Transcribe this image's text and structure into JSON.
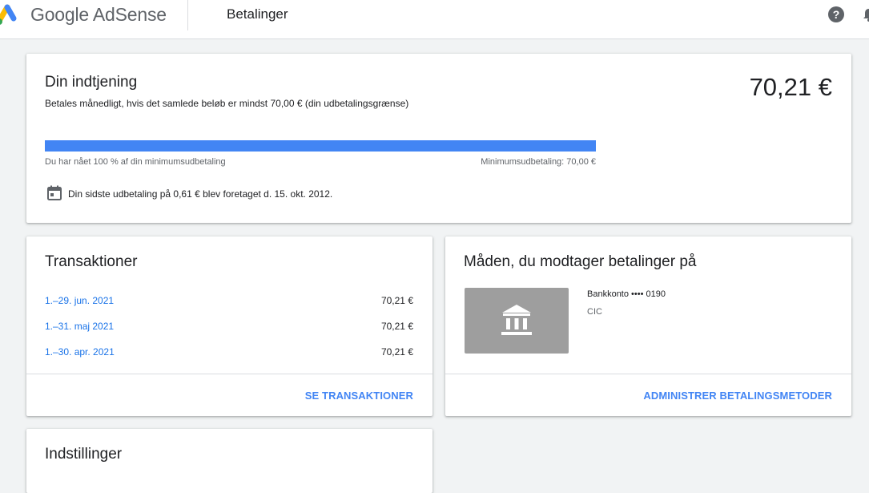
{
  "header": {
    "brand": "Google AdSense",
    "page_title": "Betalinger",
    "icons": {
      "help": "help-icon",
      "notifications": "bell-icon",
      "logo": "adsense-logo-icon"
    }
  },
  "earnings": {
    "title": "Din indtjening",
    "subtitle": "Betales månedligt, hvis det samlede beløb er mindst 70,00 € (din udbetalingsgrænse)",
    "amount": "70,21 €",
    "progress_percent": 100,
    "progress_caption": "Du har nået 100 % af din minimumsudbetaling",
    "threshold_caption": "Minimumsudbetaling: 70,00 €",
    "last_payment": "Din sidste udbetaling på 0,61 € blev foretaget d. 15. okt. 2012.",
    "calendar_icon": "calendar-icon"
  },
  "transactions": {
    "title": "Transaktioner",
    "rows": [
      {
        "period": "1.–29. jun. 2021",
        "amount": "70,21 €"
      },
      {
        "period": "1.–31. maj 2021",
        "amount": "70,21 €"
      },
      {
        "period": "1.–30. apr. 2021",
        "amount": "70,21 €"
      }
    ],
    "action": "SE TRANSAKTIONER"
  },
  "payment_method": {
    "title": "Måden, du modtager betalinger på",
    "account": "Bankkonto •••• 0190",
    "bank": "CIC",
    "bank_icon": "bank-icon",
    "action": "ADMINISTRER BETALINGSMETODER"
  },
  "settings": {
    "title": "Indstillinger"
  },
  "colors": {
    "accent": "#4285f4",
    "link": "#1a73e8",
    "background": "#f1f3f4",
    "bank_tile": "#9e9e9e"
  }
}
